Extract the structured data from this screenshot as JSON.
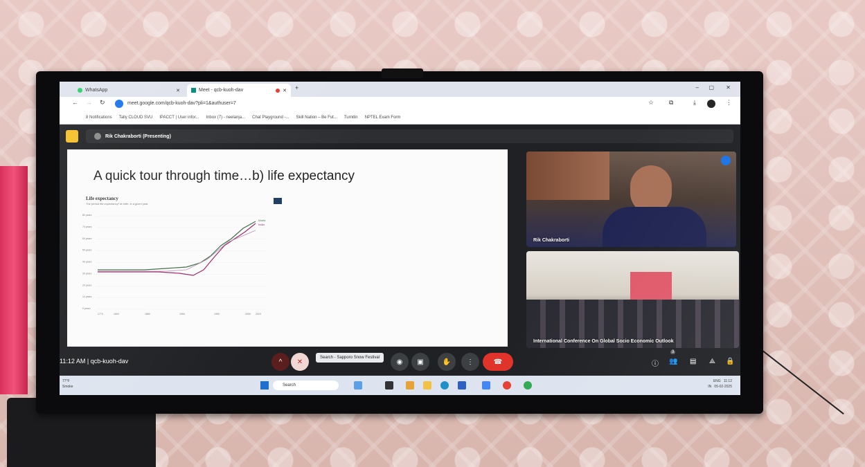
{
  "browser": {
    "tabs": [
      {
        "label": "WhatsApp",
        "icon": "whatsapp-icon"
      },
      {
        "label": "Meet - qcb-kuoh-dav",
        "icon": "meet-icon"
      }
    ],
    "url": "meet.google.com/qcb-kuoh-dav?pli=1&authuser=7",
    "bookmarks": [
      "8 Notifications",
      "Tally CLOUD SVU",
      "IPACCT | User infor...",
      "Inbox (7) - neelanja...",
      "Chat Playground -...",
      "Skill Nation – Be Fut...",
      "Turnitin",
      "NPTEL Exam Form"
    ]
  },
  "meet": {
    "presenter_label": "Rik Chakraborti (Presenting)",
    "slide": {
      "title": "A quick tour through time…b) life expectancy",
      "chart_title": "Life expectancy",
      "chart_subtitle": "The period life expectancy¹ at birth, in a given year.",
      "series_labels": [
        "World",
        "India"
      ],
      "y_ticks": [
        "80 years",
        "70 years",
        "60 years",
        "50 years",
        "40 years",
        "30 years",
        "20 years",
        "10 years",
        "0 years"
      ],
      "x_ticks": [
        "1770",
        "1800",
        "1850",
        "1900",
        "1950",
        "2000",
        "2023"
      ]
    },
    "participants": [
      {
        "name": "Rik Chakraborti"
      },
      {
        "name": "International Conference On Global Socio Economic Outlook"
      }
    ],
    "meeting_time": "11:12 AM",
    "meeting_code": "qcb-kuoh-dav",
    "tooltip": "Search - Sapporo Snow Festival",
    "participant_count": "3"
  },
  "taskbar": {
    "weather_temp": "77°F",
    "weather_desc": "Smoke",
    "search_placeholder": "Search",
    "lang": "ENG",
    "region": "IN",
    "clock_time": "11:12",
    "clock_date": "05-02-2025"
  },
  "colors": {
    "end_call": "#e0342b",
    "meet_bg": "#202124",
    "world_line": "#3d6b46",
    "india_line": "#9b2a68"
  }
}
